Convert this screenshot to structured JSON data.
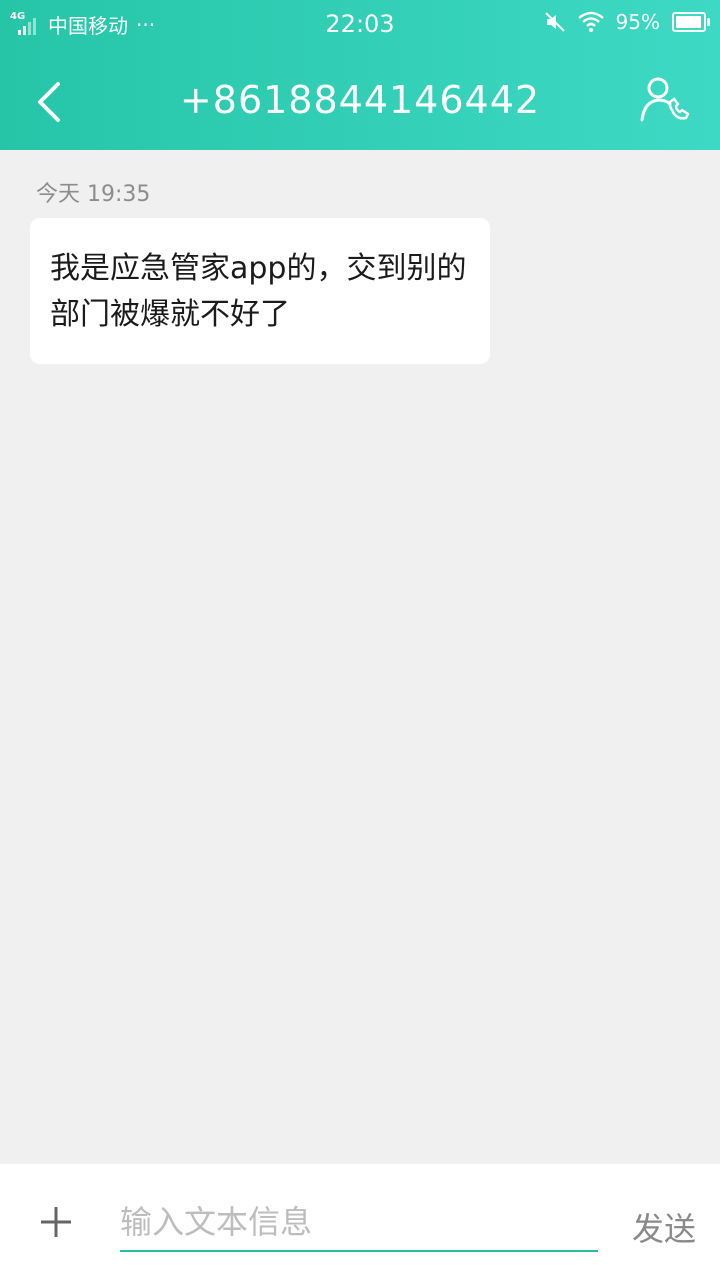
{
  "status_bar": {
    "network_type": "4G",
    "carrier": "中国移动",
    "more": "···",
    "time": "22:03",
    "battery_percent": "95%",
    "battery_level": 0.95,
    "icons": [
      "signal-icon",
      "mute-icon",
      "wifi-icon",
      "battery-icon"
    ]
  },
  "header": {
    "contact_number": "+8618844146442",
    "back_icon": "chevron-left-icon",
    "contact_icon": "contact-call-icon"
  },
  "conversation": {
    "timestamp": "今天 19:35",
    "messages": [
      {
        "direction": "incoming",
        "text": "我是应急管家app的，交到别的部门被爆就不好了"
      }
    ]
  },
  "composer": {
    "add_icon": "plus-icon",
    "placeholder": "输入文本信息",
    "value": "",
    "send_label": "发送"
  },
  "colors": {
    "header_gradient_start": "#26c5a8",
    "header_gradient_end": "#3ed9c4",
    "background": "#f0f0f0",
    "input_underline": "#26bda6"
  }
}
